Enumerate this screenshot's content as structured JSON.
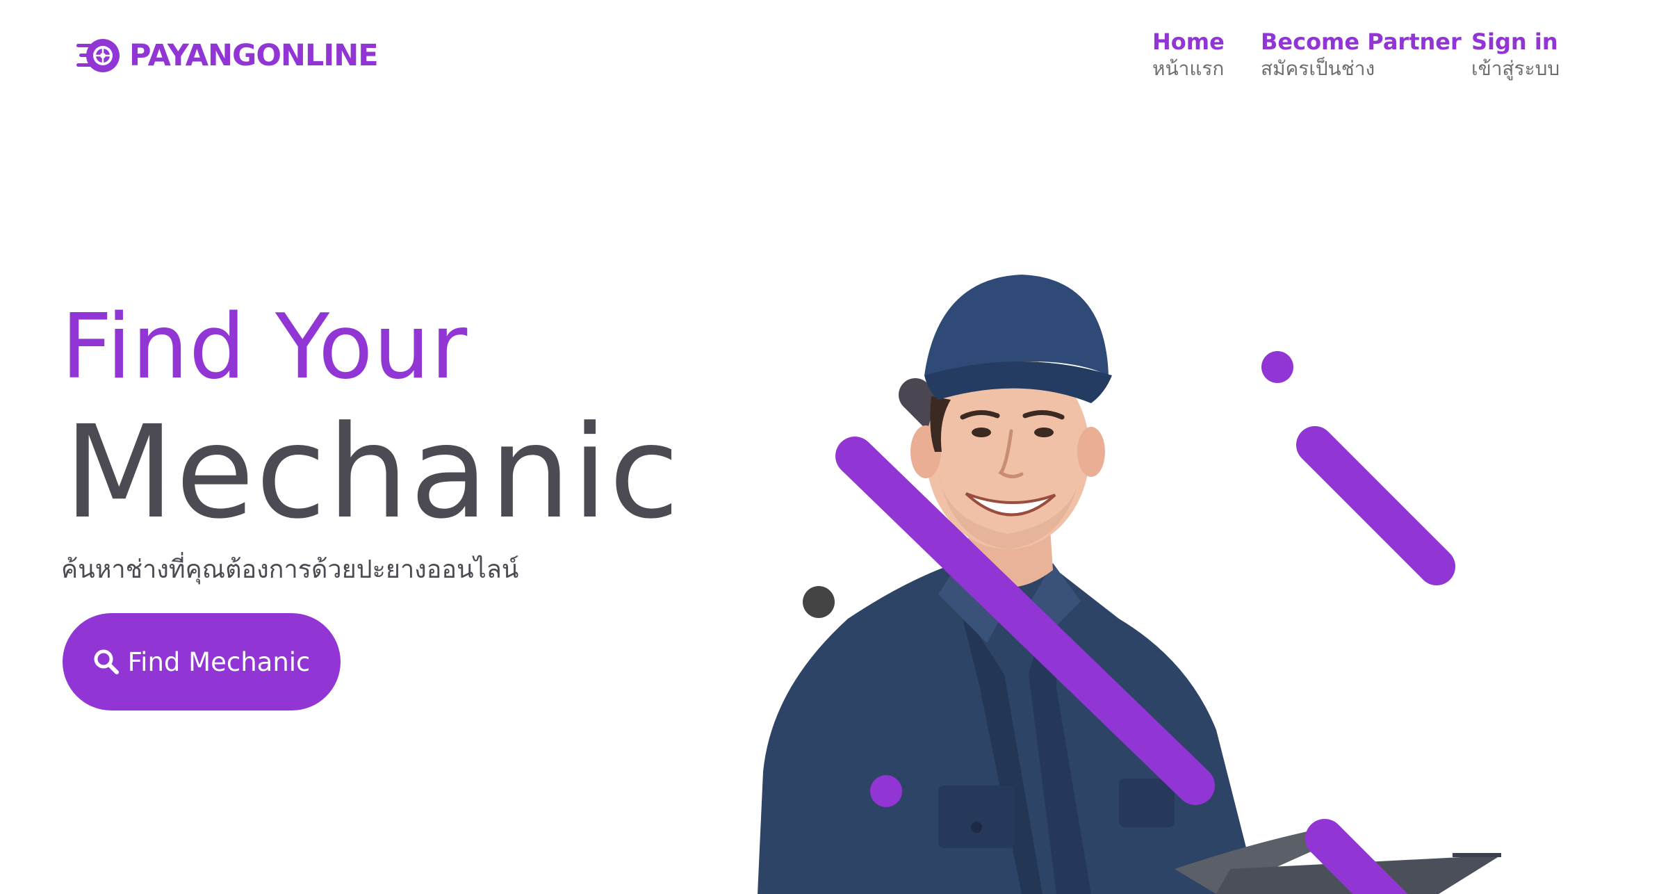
{
  "brand": {
    "name": "PAYANGONLINE",
    "logo_icon": "tire-logo-icon",
    "accent_color": "#9135d4",
    "text_dark_color": "#4c4a52"
  },
  "nav": {
    "items": [
      {
        "label": "Home",
        "sublabel": "หน้าแรก"
      },
      {
        "label": "Become Partner",
        "sublabel": "สมัครเป็นช่าง"
      },
      {
        "label": "Sign in",
        "sublabel": "เข้าสู่ระบบ"
      }
    ]
  },
  "hero": {
    "title_line1": "Find Your",
    "title_line2": "Mechanic",
    "subtitle": "ค้นหาช่างที่คุณต้องการด้วยปะยางออนไลน์",
    "cta_label": "Find Mechanic",
    "cta_icon": "search-icon"
  },
  "illustration": {
    "subject": "mechanic-photo",
    "decor_colors": [
      "#9135d4",
      "#4c4552",
      "#444444"
    ]
  }
}
